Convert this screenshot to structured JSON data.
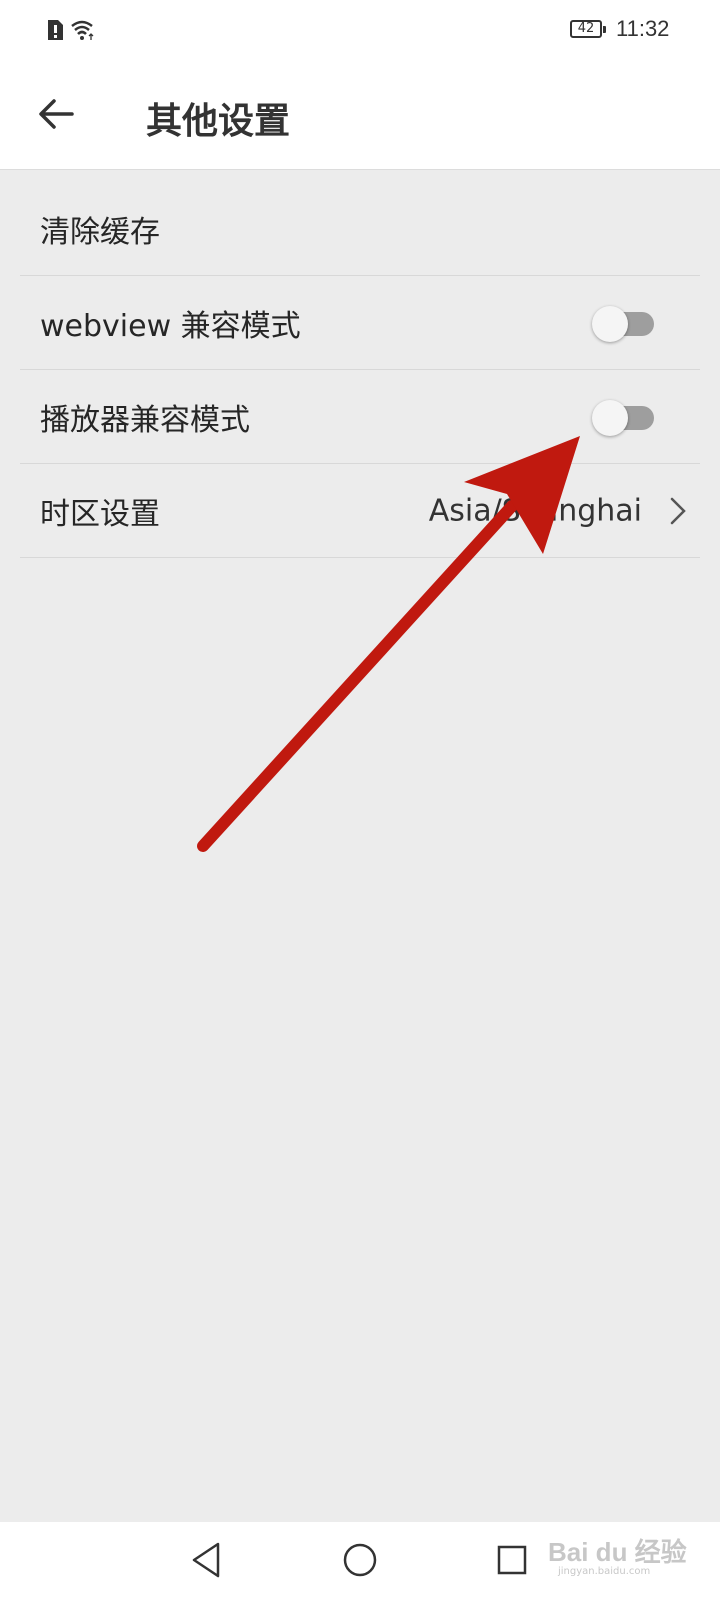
{
  "status_bar": {
    "battery_level": "42",
    "time": "11:32",
    "icons": [
      "sim-alert-icon",
      "wifi-icon",
      "battery-icon"
    ]
  },
  "header": {
    "title": "其他设置",
    "back_icon": "arrow-left-icon"
  },
  "settings": [
    {
      "label": "清除缓存",
      "type": "action"
    },
    {
      "label": "webview 兼容模式",
      "type": "toggle",
      "enabled": false
    },
    {
      "label": "播放器兼容模式",
      "type": "toggle",
      "enabled": false
    },
    {
      "label": "时区设置",
      "type": "link",
      "value": "Asia/Shanghai",
      "icon": "chevron-right-icon"
    }
  ],
  "annotation": {
    "color": "#c0190f",
    "icon": "red-arrow-annotation"
  },
  "nav_bar": {
    "icons": [
      "nav-back-triangle-icon",
      "nav-home-circle-icon",
      "nav-recents-square-icon"
    ]
  },
  "watermark": {
    "brand": "Bai du 经验",
    "url": "jingyan.baidu.com"
  }
}
